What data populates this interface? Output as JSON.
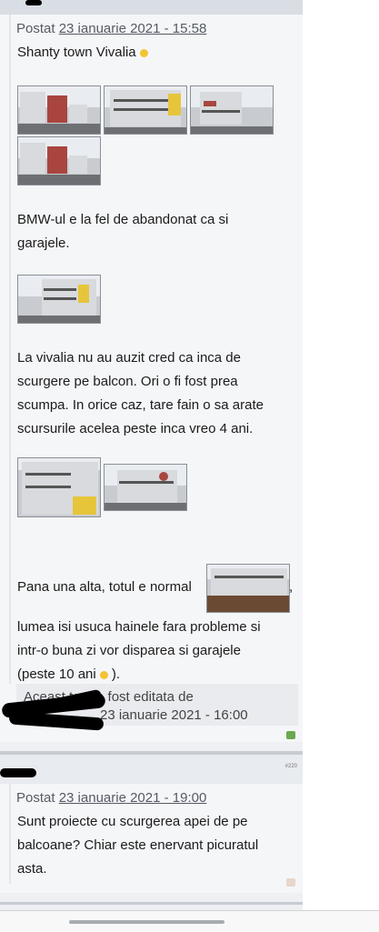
{
  "post1": {
    "posted_prefix": "Postat",
    "posted_date": "23 ianuarie 2021 - 15:58",
    "title": "Shanty town Vivalia",
    "para1_line1": "BMW-ul e la fel de abandonat ca si",
    "para1_line2": "garajele.",
    "para2_line1": "La vivalia nu au auzit cred ca inca de",
    "para2_line2": "scurgere pe balcon. Ori o fi fost prea",
    "para2_line3": "scumpa. In orice caz, tare fain o sa arate",
    "para2_line4": "scursurile acelea peste inca vreo 4 ani.",
    "para3_line1": "Pana una alta, totul e normal",
    "para3_line1_tail": ",",
    "para3_line2": "lumea isi usuca hainele fara probleme si",
    "para3_line3": "intr-o buna zi vor disparea si garajele",
    "para3_line4a": "(peste 10 ani",
    "para3_line4b": ").",
    "edited_line1": "Aceast          tare a fost editata de",
    "edited_line2": "23 ianuarie 2021 - 16:00"
  },
  "post2": {
    "number": "#220",
    "posted_prefix": "Postat",
    "posted_date": "23 ianuarie 2021 - 19:00",
    "line1": "Sunt proiecte cu scurgerea apei de pe",
    "line2": "balcoane? Chiar este enervant picuratul",
    "line3": "asta."
  },
  "colors": {
    "background": "#eef0f3",
    "post_bg": "#f5f6f8",
    "separator": "#c7ccd3",
    "accent_badge": "#6aa84f",
    "smiley": "#f3c332"
  }
}
